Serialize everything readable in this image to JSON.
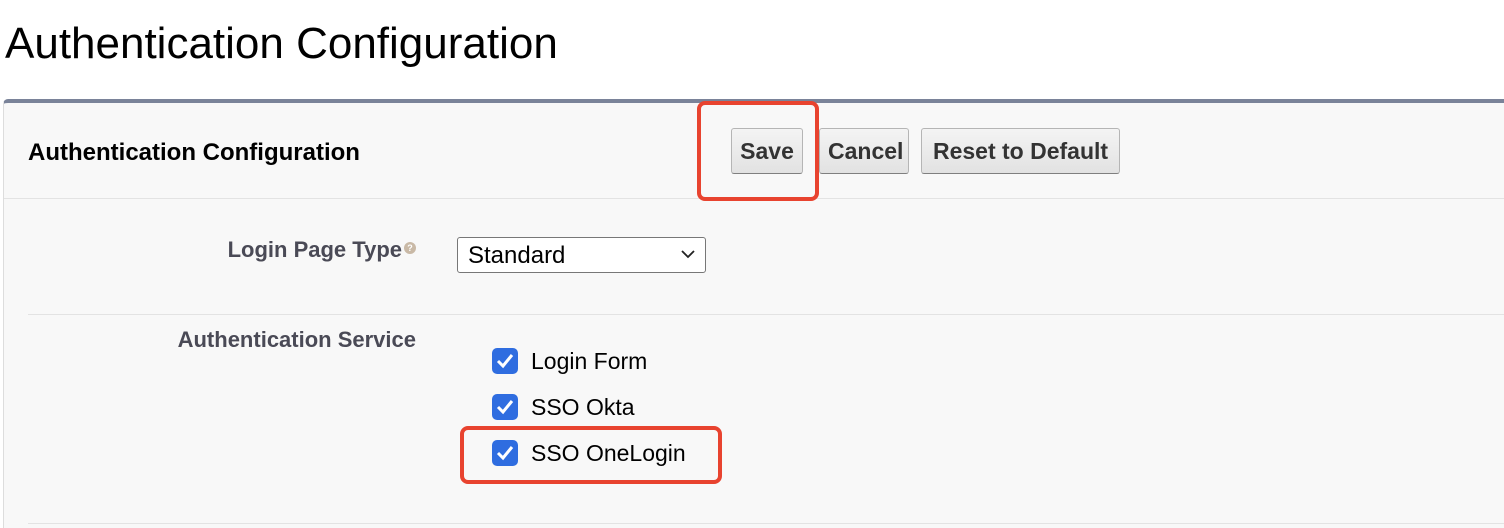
{
  "page": {
    "title": "Authentication Configuration"
  },
  "panel": {
    "title": "Authentication Configuration",
    "buttons": {
      "save": "Save",
      "cancel": "Cancel",
      "reset": "Reset to Default"
    }
  },
  "fields": {
    "login_page_type": {
      "label": "Login Page Type",
      "help_icon": "help-icon",
      "selected": "Standard"
    },
    "authentication_service": {
      "label": "Authentication Service",
      "options": [
        {
          "label": "Login Form",
          "checked": true
        },
        {
          "label": "SSO Okta",
          "checked": true
        },
        {
          "label": "SSO OneLogin",
          "checked": true
        }
      ]
    }
  },
  "colors": {
    "highlight": "#e8432f",
    "checkbox": "#2f6de0",
    "panel_top_border": "#7a8399"
  }
}
